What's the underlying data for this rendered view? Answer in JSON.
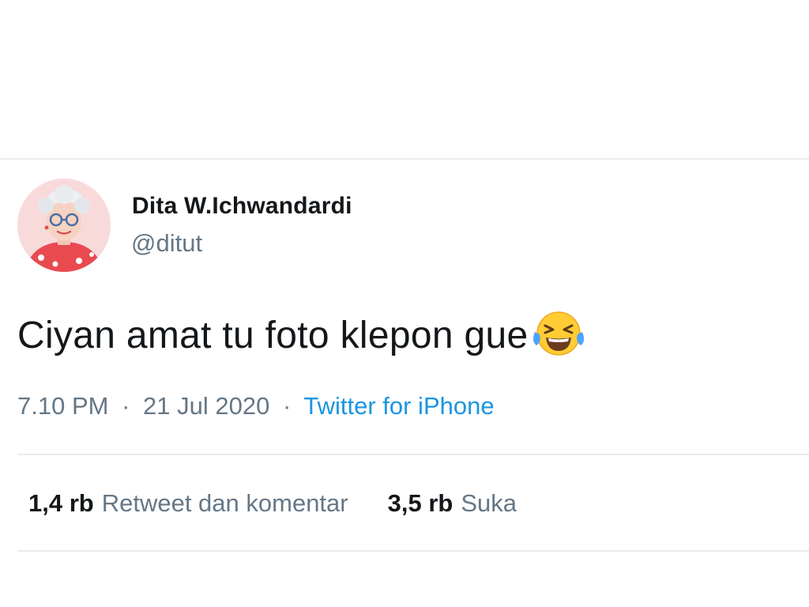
{
  "tweet": {
    "author": {
      "name": "Dita W.Ichwandardi",
      "handle": "@ditut",
      "avatar_icon": "profile-avatar"
    },
    "text": "Ciyan amat tu foto klepon gue",
    "emoji_icon": "face-with-tears-of-joy-icon",
    "time": "7.10 PM",
    "date": "21 Jul 2020",
    "separator": "·",
    "source": "Twitter for iPhone",
    "stats": [
      {
        "count": "1,4 rb",
        "label": "Retweet dan komentar"
      },
      {
        "count": "3,5 rb",
        "label": "Suka"
      }
    ]
  },
  "colors": {
    "text_primary": "#14171a",
    "text_secondary": "#657786",
    "link": "#1b95e0",
    "divider": "#e6ecf0"
  }
}
